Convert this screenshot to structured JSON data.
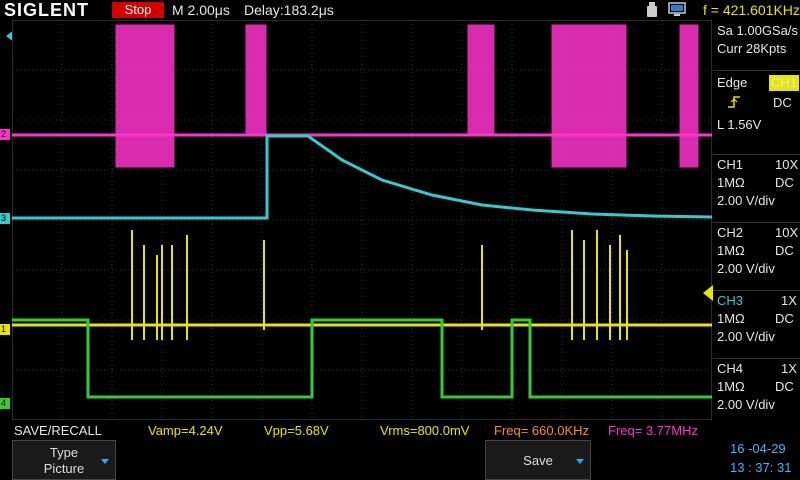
{
  "topbar": {
    "brand": "SIGLENT",
    "state": "Stop",
    "timebase": "M 2.00μs",
    "delay": "Delay:183.2μs",
    "trigger_freq": "f = 421.601KHz",
    "usb_icon": "usb-icon",
    "pc_icon": "pc-connection-icon"
  },
  "acquisition": {
    "sample_rate": "Sa 1.00GSa/s",
    "memory": "Curr 28Kpts"
  },
  "trigger": {
    "type": "Edge",
    "source": "CH1",
    "coupling": "DC",
    "level": "L  1.56V",
    "slope_icon": "rising-edge-icon"
  },
  "channels": [
    {
      "name": "CH1",
      "probe": "10X",
      "impedance": "1MΩ",
      "coupling": "DC",
      "scale": "2.00 V/div",
      "color": "#e6e600"
    },
    {
      "name": "CH2",
      "probe": "10X",
      "impedance": "1MΩ",
      "coupling": "DC",
      "scale": "2.00 V/div",
      "color": "#ff33cc"
    },
    {
      "name": "CH3",
      "probe": "1X",
      "impedance": "1MΩ",
      "coupling": "DC",
      "scale": "2.00 V/div",
      "color": "#33cccc"
    },
    {
      "name": "CH4",
      "probe": "1X",
      "impedance": "1MΩ",
      "coupling": "DC",
      "scale": "2.00 V/div",
      "color": "#33cc33"
    }
  ],
  "channel_markers": [
    "2",
    "3",
    "1",
    "4"
  ],
  "measurements": {
    "menu": "SAVE/RECALL",
    "vamp": "Vamp=4.24V",
    "vpp": "Vpp=5.68V",
    "vrms": "Vrms=800.0mV",
    "freq1": "Freq= 660.0KHz",
    "freq2": "Freq= 3.77MHz"
  },
  "softkeys": {
    "type_line1": "Type",
    "type_line2": "Picture",
    "save": "Save"
  },
  "clock": {
    "date": "16 -04-29",
    "time": "13 : 37: 31"
  }
}
